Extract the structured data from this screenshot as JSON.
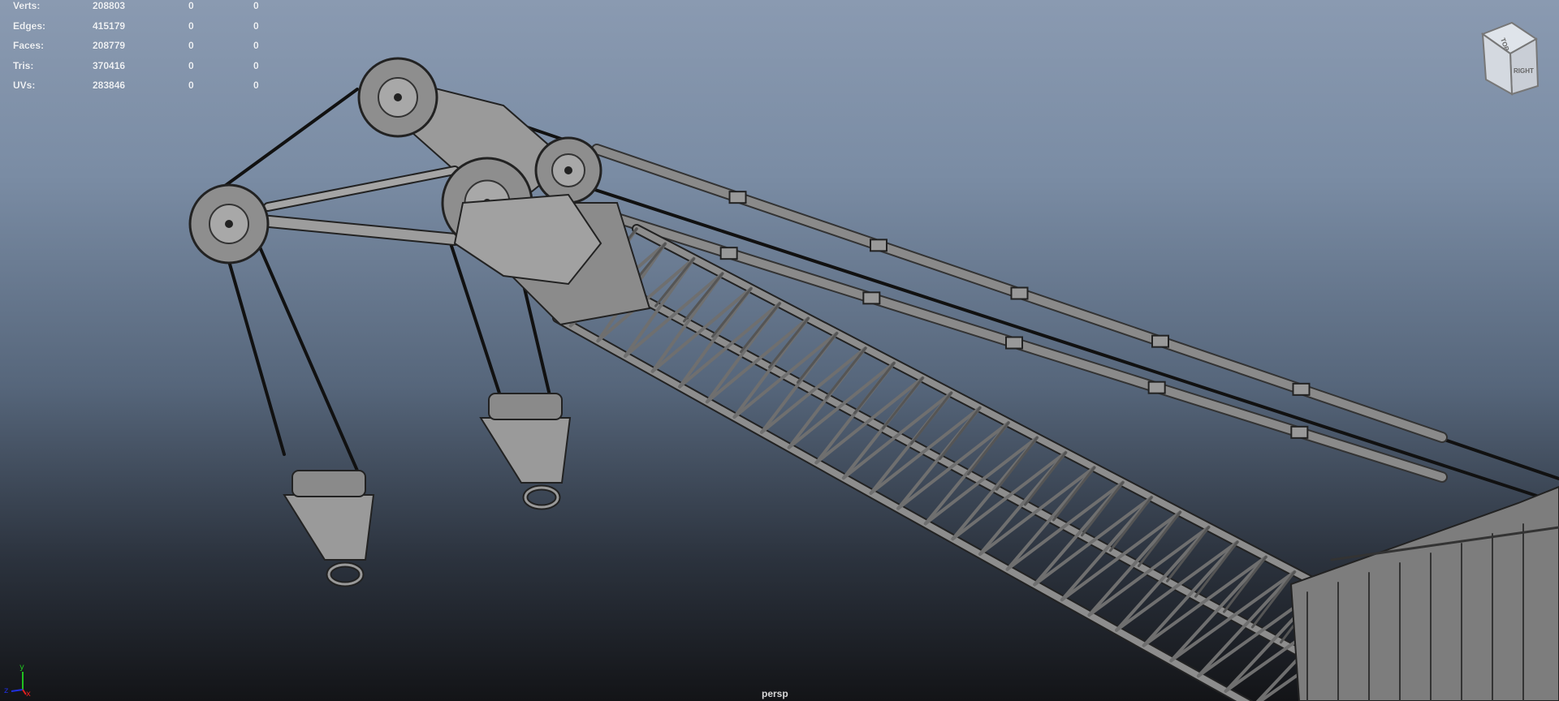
{
  "hud": {
    "rows": [
      {
        "label": "Verts:",
        "values": [
          "208803",
          "0",
          "0"
        ]
      },
      {
        "label": "Edges:",
        "values": [
          "415179",
          "0",
          "0"
        ]
      },
      {
        "label": "Faces:",
        "values": [
          "208779",
          "0",
          "0"
        ]
      },
      {
        "label": "Tris:",
        "values": [
          "370416",
          "0",
          "0"
        ]
      },
      {
        "label": "UVs:",
        "values": [
          "283846",
          "0",
          "0"
        ]
      }
    ]
  },
  "viewcube": {
    "top": "TOP",
    "right": "RIGHT"
  },
  "axis": {
    "x": "x",
    "y": "y",
    "z": "z",
    "colors": {
      "x": "#e02020",
      "y": "#20c020",
      "z": "#2030e0"
    }
  },
  "camera_label": "persp"
}
